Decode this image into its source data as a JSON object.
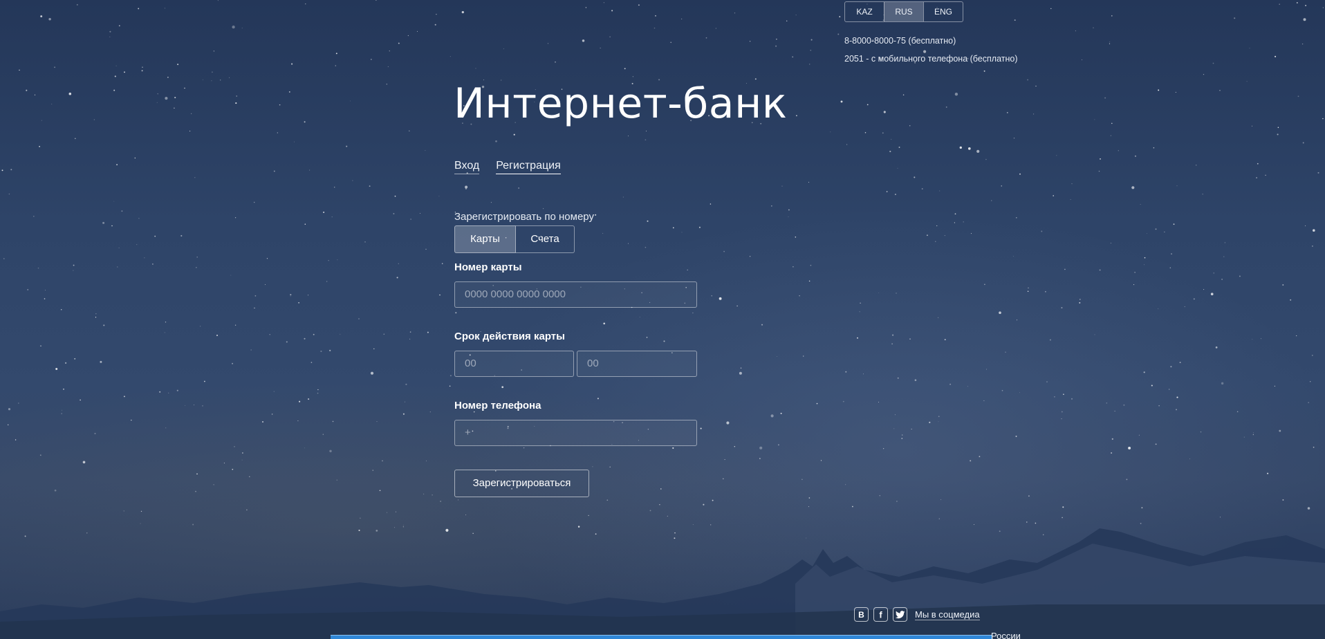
{
  "lang": {
    "items": [
      "KAZ",
      "RUS",
      "ENG"
    ],
    "active": "RUS"
  },
  "contacts": {
    "line1": "8-8000-8000-75 (бесплатно)",
    "line2": "2051 - с мобильного телефона (бесплатно)"
  },
  "title": "Интернет-банк",
  "nav": {
    "login": "Вход",
    "register": "Регистрация"
  },
  "register_by": {
    "label": "Зарегистрировать по номеру",
    "options": [
      "Карты",
      "Счета"
    ],
    "selected": "Карты"
  },
  "card_number": {
    "label": "Номер карты",
    "placeholder": "0000 0000 0000 0000"
  },
  "expiry": {
    "label": "Срок действия карты",
    "month_placeholder": "00",
    "year_placeholder": "00"
  },
  "phone": {
    "label": "Номер телефона",
    "placeholder": "+"
  },
  "submit_label": "Зарегистрироваться",
  "social": {
    "icons": [
      "vk-icon",
      "facebook-icon",
      "twitter-icon"
    ],
    "link": "Мы в соцмедиа"
  },
  "footer_fragment": "России",
  "colors": {
    "accent_bar": "#2f86d6",
    "background": "#2b3f62"
  }
}
